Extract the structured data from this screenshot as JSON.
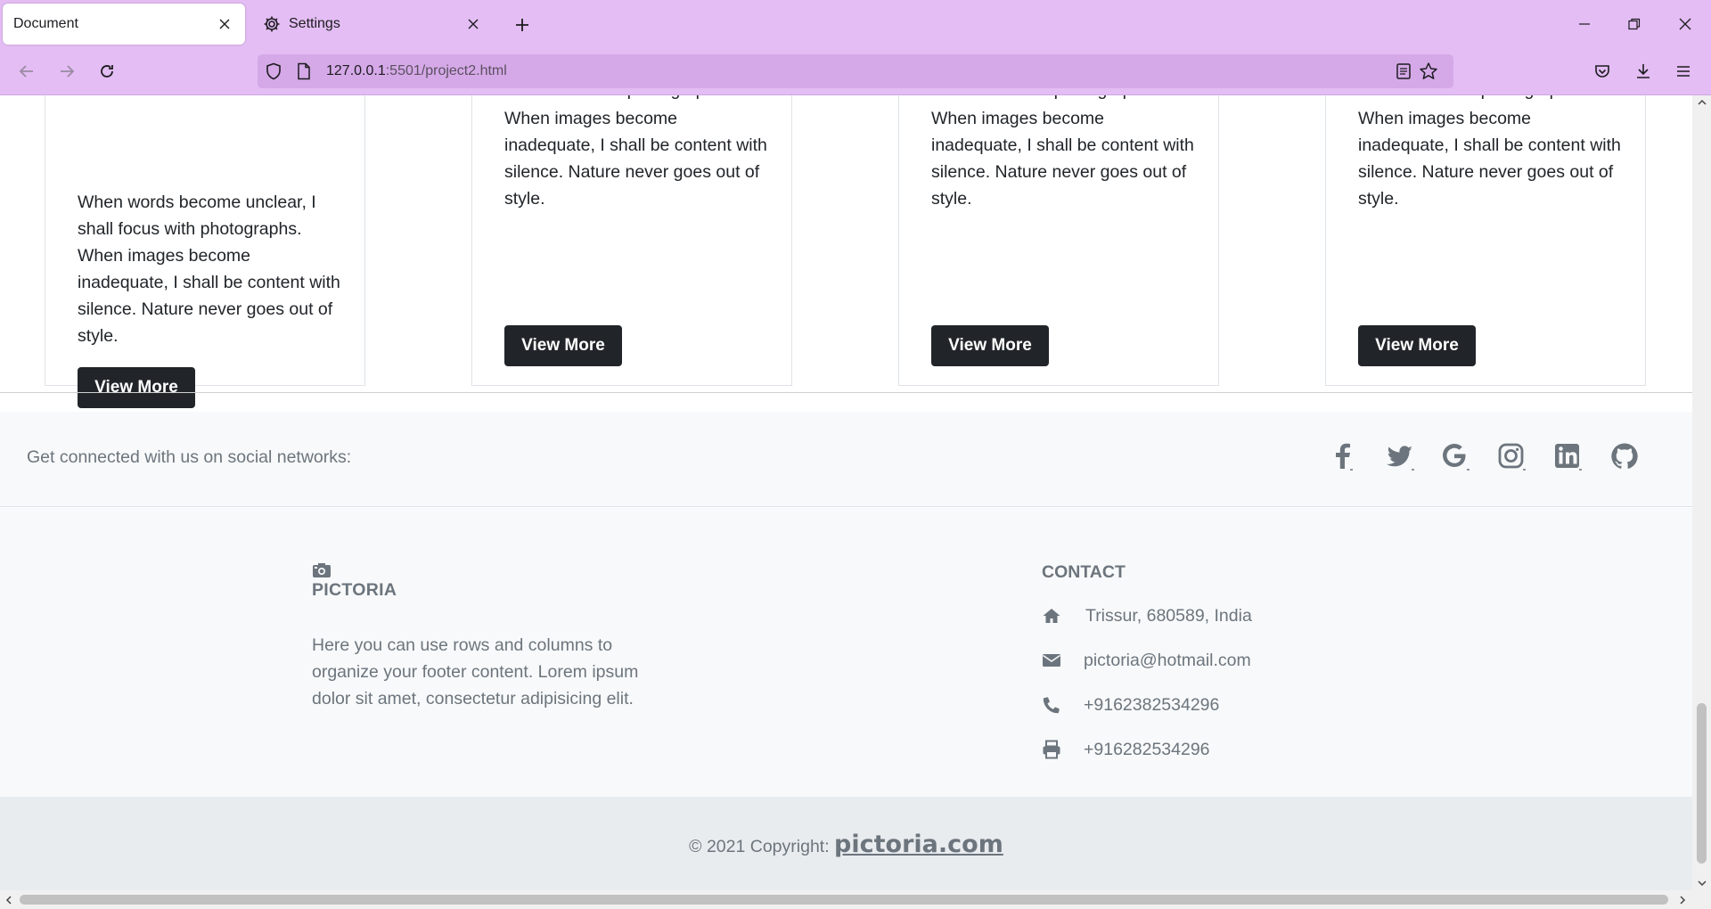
{
  "browser": {
    "tabs": [
      {
        "label": "Document",
        "active": true
      },
      {
        "label": "Settings",
        "active": false,
        "icon": "gear-icon"
      }
    ],
    "url": {
      "host": "127.0.0.1",
      "rest": ":5501/project2.html"
    }
  },
  "cards": [
    {
      "text": "When words become unclear, I shall focus with photographs. When images become inadequate, I shall be content with silence. Nature never goes out of style.",
      "button": "View More"
    },
    {
      "text_partial": "shall focus with photographs.",
      "text": "When images become inadequate, I shall be content with silence. Nature never goes out of style.",
      "button": "View More"
    },
    {
      "text_partial": "shall focus with photographs.",
      "text": "When images become inadequate, I shall be content with silence. Nature never goes out of style.",
      "button": "View More"
    },
    {
      "text_partial": "shall focus with photographs.",
      "text": "When images become inadequate, I shall be content with silence. Nature never goes out of style.",
      "button": "View More"
    }
  ],
  "social": {
    "text": "Get connected with us on social networks:",
    "icons": [
      "facebook-icon",
      "twitter-icon",
      "google-icon",
      "instagram-icon",
      "linkedin-icon",
      "github-icon"
    ]
  },
  "footer": {
    "brand": "PICTORIA",
    "brand_icon": "camera-icon",
    "description": "Here you can use rows and columns to organize your footer content. Lorem ipsum dolor sit amet, consectetur adipisicing elit.",
    "contact_title": "CONTACT",
    "contacts": [
      {
        "icon": "home-icon",
        "text": "Trissur, 680589, India"
      },
      {
        "icon": "envelope-icon",
        "text": "pictoria@hotmail.com"
      },
      {
        "icon": "phone-icon",
        "text": "+9162382534296"
      },
      {
        "icon": "printer-icon",
        "text": "+916282534296"
      }
    ]
  },
  "copyright": {
    "prefix": "© 2021 Copyright: ",
    "link": "pictoria.com"
  },
  "colors": {
    "chrome": "#e3bdf3",
    "urlbar": "#d5a9e8",
    "button": "#212529",
    "footer_text": "#6c757d",
    "footer_bg": "#f8f9fa",
    "copyright_bg": "#e9ecef"
  }
}
